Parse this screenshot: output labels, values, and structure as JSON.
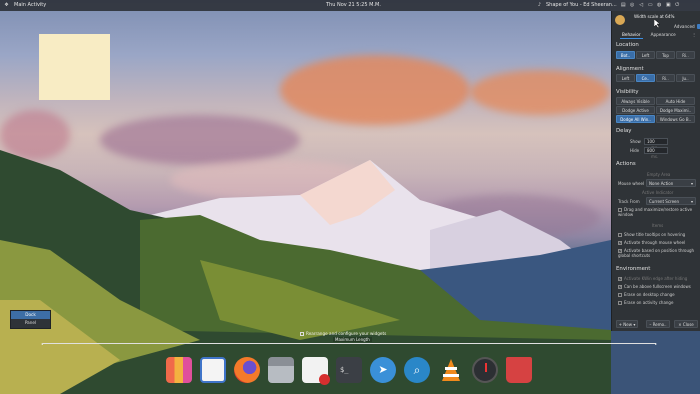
{
  "topbar": {
    "activity": "Main Activity",
    "clock": "Thu Nov 21 5:25 M.M.",
    "media": "Shape of You - Ed Sheeran..."
  },
  "icons": {
    "activity": "kde-icon",
    "media": "music-icon",
    "tray": [
      "clipboard-icon",
      "network-icon",
      "volume-icon",
      "battery-icon",
      "notifications-icon",
      "display-icon",
      "power-icon"
    ],
    "dock": [
      "photo-collage-icon",
      "document-icon",
      "firefox-icon",
      "file-manager-icon",
      "text-editor-icon",
      "terminal-icon",
      "telegram-icon",
      "search-icon",
      "vlc-icon",
      "clock-icon",
      "trash-icon"
    ]
  },
  "context_menu": {
    "items": [
      "Dock",
      "Panel"
    ],
    "selected": "Dock"
  },
  "canvas": {
    "rearrange": "Rearrange and configure your widgets",
    "max_length": "Maximum Length"
  },
  "settings": {
    "width_scale": "Width scale at 64%",
    "advanced": "Advanced",
    "tabs": [
      "Behavior",
      "Appearance"
    ],
    "active_tab": "Behavior",
    "location": {
      "title": "Location",
      "options": [
        "Bot..",
        "Left",
        "Top",
        "Ri.."
      ],
      "active": "Bot.."
    },
    "alignment": {
      "title": "Alignment",
      "options": [
        "Left",
        "Ce..",
        "Ri..",
        "Ju.."
      ],
      "active": "Ce.."
    },
    "visibility": {
      "title": "Visibility",
      "options": [
        "Always Visible",
        "Auto Hide",
        "Dodge Active",
        "Dodge Maximi..",
        "Dodge All Win..",
        "Windows Go B.."
      ],
      "active": "Dodge All Win.."
    },
    "delay": {
      "title": "Delay",
      "show_label": "Show",
      "show_value": "100",
      "show_unit": "ms.",
      "hide_label": "Hide",
      "hide_value": "800",
      "hide_unit": "ms."
    },
    "actions": {
      "title": "Actions",
      "empty_area": "Empty Area",
      "mouse_wheel_label": "Mouse wheel",
      "mouse_wheel_value": "None Action",
      "active_indicator": "Active Indicator",
      "track_from_label": "Track From",
      "track_from_value": "Current Screen",
      "drag_maximize": "Drag and maximize/restore active window",
      "items": "Items",
      "show_title_tooltips": "Show title tooltips on hovering",
      "activate_mouse_wheel": "Activate through mouse wheel",
      "activate_position": "Activate based on position through global shortcuts"
    },
    "environment": {
      "title": "Environment",
      "kwin_edge": "Activate KWin edge after hiding",
      "above_fullscreen": "Can be above fullscreen windows",
      "erase_desktop": "Erase on desktop change",
      "erase_activity": "Erase on activity change"
    },
    "footer": {
      "new": "New",
      "remove": "Remo..",
      "close": "Close"
    }
  }
}
